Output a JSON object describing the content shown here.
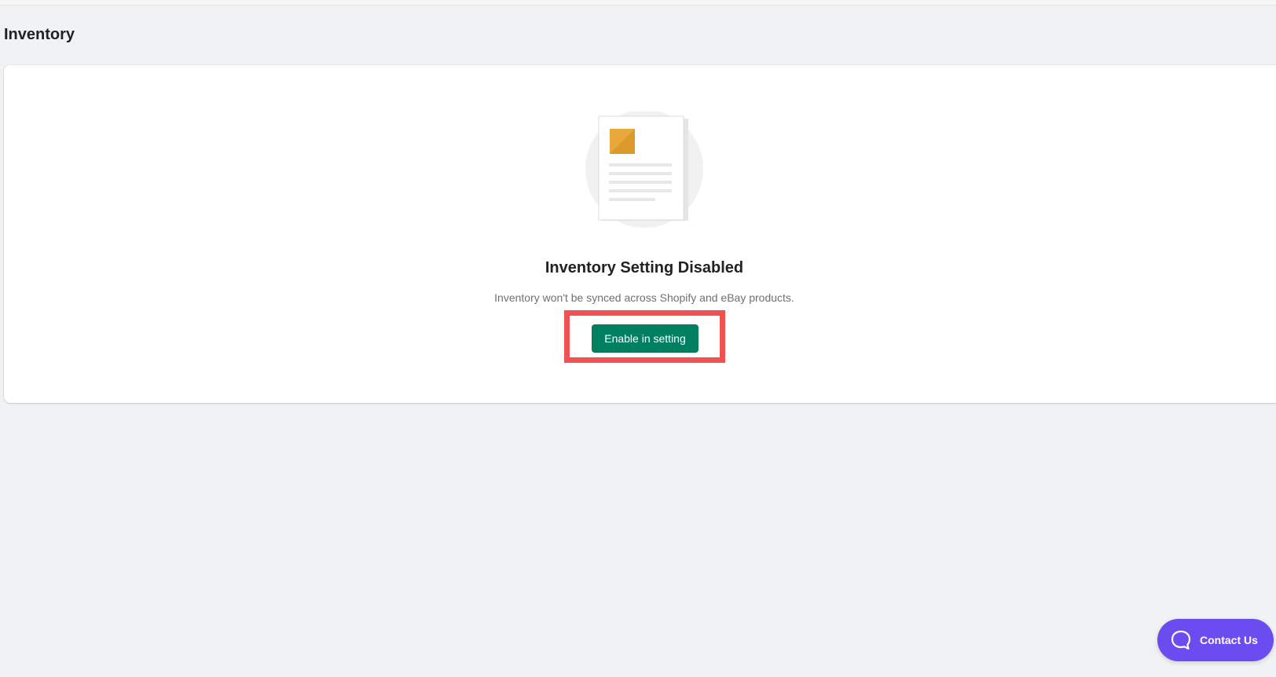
{
  "page": {
    "title": "Inventory"
  },
  "empty_state": {
    "heading": "Inventory Setting Disabled",
    "description": "Inventory won't be synced across Shopify and eBay products.",
    "action_label": "Enable in setting",
    "illustration_icon": "document-icon"
  },
  "contact": {
    "label": "Contact Us",
    "icon": "chat-bubble-icon"
  },
  "colors": {
    "primary_button": "#008060",
    "highlight": "#f05151",
    "contact_button": "#6a4cf0",
    "illustration_accent": "#e8a93a"
  }
}
